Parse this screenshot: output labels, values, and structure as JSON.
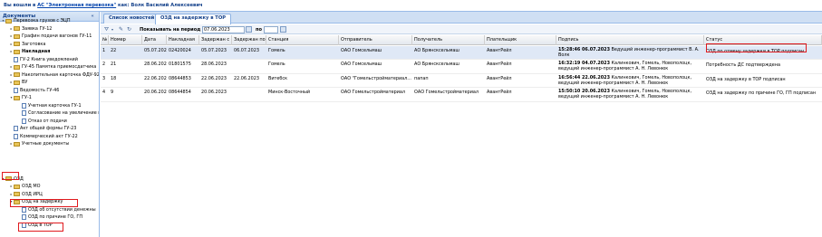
{
  "topbar": {
    "prefix": "Вы вошли в",
    "system_link": "АС \"Электронная перевозка\"",
    "as_text": "как:",
    "user": "Волк Василий Алексеевич"
  },
  "left_panel": {
    "title": "Документы",
    "collapse_icon": "«",
    "tree": [
      {
        "label": "Перевозка грузов с ЭЦП",
        "icon": "folder",
        "expand": "▾",
        "bold": false
      },
      {
        "label": "Заявка ГУ-12",
        "icon": "folder",
        "expand": "▸",
        "bold": false
      },
      {
        "label": "Графин подачи вагонов ГУ-11",
        "icon": "folder",
        "expand": "▸",
        "bold": false
      },
      {
        "label": "Заготовка",
        "icon": "folder",
        "expand": "▸",
        "bold": false
      },
      {
        "label": "Накладная",
        "icon": "folder",
        "expand": "▸",
        "bold": true
      },
      {
        "label": "ГУ-2 Книга уведомлений",
        "icon": "doc",
        "expand": "",
        "bold": false
      },
      {
        "label": "ГУ-45 Памятка приемосдатчика",
        "icon": "folder",
        "expand": "▸",
        "bold": false
      },
      {
        "label": "Накопительная карточка ФДУ-92",
        "icon": "folder",
        "expand": "▸",
        "bold": false
      },
      {
        "label": "ВУ",
        "icon": "folder",
        "expand": "▸",
        "bold": false
      },
      {
        "label": "Ведомость ГУ-46",
        "icon": "doc",
        "expand": "",
        "bold": false
      },
      {
        "label": "ГУ-1",
        "icon": "folder",
        "expand": "▾",
        "bold": false
      },
      {
        "label": "Учетная карточка ГУ-1",
        "icon": "doc",
        "expand": "",
        "bold": false
      },
      {
        "label": "Согласование на увеличение по",
        "icon": "doc",
        "expand": "",
        "bold": false
      },
      {
        "label": "Отказ от подачи",
        "icon": "doc",
        "expand": "",
        "bold": false
      },
      {
        "label": "Акт общей формы ГУ-23",
        "icon": "doc",
        "expand": "",
        "bold": false
      },
      {
        "label": "Коммерческий акт ГУ-22",
        "icon": "doc",
        "expand": "",
        "bold": false
      },
      {
        "label": "Учетные документы",
        "icon": "folder",
        "expand": "▸",
        "bold": false
      },
      {
        "label": "ОЗД",
        "icon": "folder",
        "expand": "▾",
        "bold": false
      },
      {
        "label": "ОЗД МО",
        "icon": "folder",
        "expand": "▸",
        "bold": false
      },
      {
        "label": "ОЗД ИРЦ",
        "icon": "folder",
        "expand": "▸",
        "bold": false
      },
      {
        "label": "ОЗД на задержку",
        "icon": "folder",
        "expand": "▾",
        "bold": false
      },
      {
        "label": "ОЗД об отсутствии денежны",
        "icon": "doc",
        "expand": "",
        "bold": false
      },
      {
        "label": "ОЗД по причине ГО, ГП",
        "icon": "doc",
        "expand": "",
        "bold": false
      },
      {
        "label": "ОЗД в ТОР",
        "icon": "doc",
        "expand": "",
        "bold": false
      }
    ]
  },
  "tabs": [
    {
      "label": "Список новостей",
      "active": false
    },
    {
      "label": "ОЗД на задержку в ТОР",
      "active": true
    }
  ],
  "toolbar": {
    "filter_icon": "filter-icon",
    "period_label": "Показывать на период с",
    "date_from": "07.06.2023",
    "to_label": "по",
    "date_to": ""
  },
  "grid": {
    "columns": [
      "№",
      "Номер",
      "Дата",
      "Накладная",
      "Задержан с",
      "Задержан по",
      "Станция",
      "Отправитель",
      "Получатель",
      "Плательщик",
      "Подпись",
      "Статус"
    ],
    "rows": [
      {
        "n": "1",
        "num": "22",
        "date": "05.07.2023",
        "waybill": "02420024",
        "from": "05.07.2023",
        "to": "06.07.2023",
        "station": "Гомель",
        "sender": "ОАО Гомсельмаш",
        "receiver": "АО Брянсксельмаш",
        "payer": "АвантРейл",
        "sign_time": "15:28:46 06.07.2023",
        "sign_rest": "Ведущий инженер-программист В. А. Волк",
        "status": "ОЗД по отмену задержки в ТОР подписан",
        "selected": true
      },
      {
        "n": "2",
        "num": "21",
        "date": "28.06.2023",
        "waybill": "01801575",
        "from": "28.06.2023",
        "to": "",
        "station": "Гомель",
        "sender": "ОАО Гомсельмаш",
        "receiver": "АО Брянсксельмаш",
        "payer": "АвантРейл",
        "sign_time": "16:32:19 04.07.2023",
        "sign_rest": "Калинкович, Гомель, Новополоцк, ведущий инженер-программист А. Н. Левонюк",
        "status": "Потребность ДС подтверждена",
        "selected": false
      },
      {
        "n": "3",
        "num": "18",
        "date": "22.06.2023",
        "waybill": "08644853",
        "from": "22.06.2023",
        "to": "22.06.2023",
        "station": "Витебск",
        "sender": "ОАО \"Гомельстройматериал...",
        "receiver": "папап",
        "payer": "АвантРейл",
        "sign_time": "16:56:44 22.06.2023",
        "sign_rest": "Калинкович, Гомель, Новополоцк, ведущий инженер-программист А. Н. Левонюк",
        "status": "ОЗД на задержку в ТОР подписан",
        "selected": false
      },
      {
        "n": "4",
        "num": "9",
        "date": "20.06.2023",
        "waybill": "08644854",
        "from": "20.06.2023",
        "to": "",
        "station": "Минск-Восточный",
        "sender": "ОАО Гомельстройматериал",
        "receiver": "ОАО Гомельстройматериал",
        "payer": "АвантРейл",
        "sign_time": "15:50:10 20.06.2023",
        "sign_rest": "Калинкович, Гомель, Новополоцк, ведущий инженер-программист А. Н. Левонюк",
        "status": "ОЗД на задержку по причине ГО, ГП подписан",
        "selected": false
      }
    ]
  },
  "colors": {
    "highlight": "#e0191d",
    "selected_row": "#dfe8f6",
    "header_blue": "#15428b"
  }
}
